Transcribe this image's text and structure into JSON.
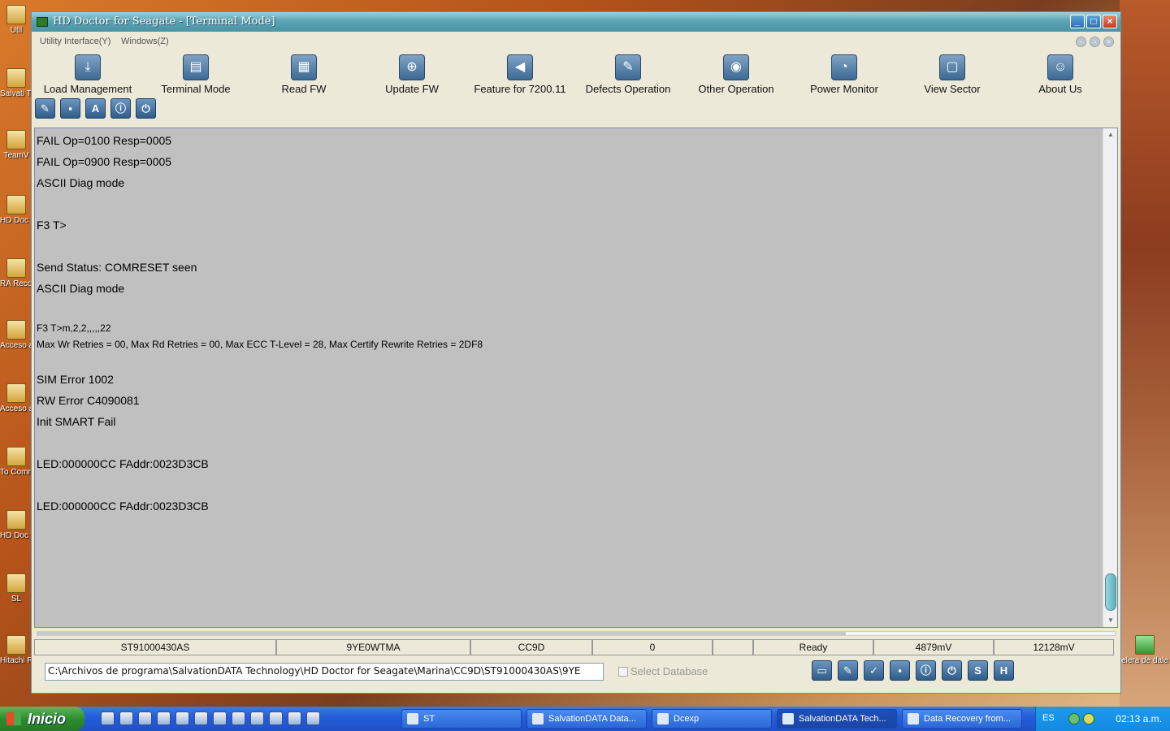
{
  "desktop": {
    "left_icons": [
      {
        "label": "Util"
      },
      {
        "label": "Salvati Techn"
      },
      {
        "label": "TeamV"
      },
      {
        "label": "HD Doc Hita"
      },
      {
        "label": "RA Recor"
      },
      {
        "label": "Acceso a Cryst"
      },
      {
        "label": "Acceso a testd"
      },
      {
        "label": "To Comm"
      },
      {
        "label": "HD Doc Wester"
      },
      {
        "label": "SL"
      },
      {
        "label": "Hitachi Repai"
      }
    ],
    "right_icons": [
      {
        "label": "elera de dale"
      }
    ]
  },
  "window": {
    "title": "HD Doctor for Seagate - [Terminal Mode]",
    "controls": {
      "minimize": "_",
      "maximize": "□",
      "close": "×"
    },
    "menu": [
      {
        "label": "Utility Interface(Y)"
      },
      {
        "label": "Windows(Z)"
      }
    ],
    "toolbar": [
      {
        "label": "Load Management",
        "icon": "load-management-icon",
        "glyph": "⤓"
      },
      {
        "label": "Terminal Mode",
        "icon": "terminal-icon",
        "glyph": "▤"
      },
      {
        "label": "Read FW",
        "icon": "read-fw-icon",
        "glyph": "▦"
      },
      {
        "label": "Update FW",
        "icon": "update-fw-icon",
        "glyph": "⊕"
      },
      {
        "label": "Feature for 7200.11",
        "icon": "feature-icon",
        "glyph": "◀"
      },
      {
        "label": "Defects Operation",
        "icon": "defects-icon",
        "glyph": "✎"
      },
      {
        "label": "Other Operation",
        "icon": "disc-icon",
        "glyph": "◉"
      },
      {
        "label": "Power Monitor",
        "icon": "power-monitor-icon",
        "glyph": "◔"
      },
      {
        "label": "View Sector",
        "icon": "view-sector-icon",
        "glyph": "▢"
      },
      {
        "label": "About Us",
        "icon": "about-icon",
        "glyph": "☺"
      }
    ],
    "quickbar": [
      {
        "icon": "edit-icon",
        "glyph": "✎"
      },
      {
        "icon": "save-icon",
        "glyph": "▪"
      },
      {
        "icon": "font-icon",
        "glyph": "A"
      },
      {
        "icon": "info-icon",
        "glyph": "ⓘ"
      },
      {
        "icon": "power-icon",
        "glyph": "⏻"
      }
    ],
    "terminal": {
      "lines": [
        {
          "text": " FAIL Op=0100 Resp=0005",
          "small": false
        },
        {
          "text": " FAIL Op=0900 Resp=0005",
          "small": false
        },
        {
          "text": "ASCII Diag mode",
          "small": false
        },
        {
          "text": "",
          "small": false
        },
        {
          "text": "F3 T>",
          "small": false
        },
        {
          "text": "",
          "small": false
        },
        {
          "text": "Send Status: COMRESET seen",
          "small": false
        },
        {
          "text": "ASCII Diag mode",
          "small": false
        },
        {
          "text": "",
          "small": false
        },
        {
          "text": "F3 T>m,2,2,,,,,22",
          "small": true
        },
        {
          "text": "Max Wr Retries = 00, Max Rd Retries = 00, Max ECC T-Level = 28, Max Certify Rewrite Retries = 2DF8",
          "small": true
        },
        {
          "text": "",
          "small": true
        },
        {
          "text": " SIM Error 1002",
          "small": false
        },
        {
          "text": " RW Error C4090081",
          "small": false
        },
        {
          "text": "Init SMART Fail",
          "small": false
        },
        {
          "text": "",
          "small": false
        },
        {
          "text": "LED:000000CC FAddr:0023D3CB",
          "small": false
        },
        {
          "text": "",
          "small": false
        },
        {
          "text": "LED:000000CC FAddr:0023D3CB",
          "small": false
        }
      ],
      "scroll_up": "▲",
      "scroll_down": "▼"
    },
    "progress": 0.75,
    "status": [
      {
        "text": "ST91000430AS"
      },
      {
        "text": "9YE0WTMA"
      },
      {
        "text": "CC9D"
      },
      {
        "text": "0"
      },
      {
        "text": ""
      },
      {
        "text": "Ready"
      },
      {
        "text": "4879mV"
      },
      {
        "text": "12128mV"
      }
    ],
    "path_value": "C:\\Archivos de programa\\SalvationDATA Technology\\HD Doctor for Seagate\\Marina\\CC9D\\ST91000430AS\\9YE",
    "select_database_label": "Select Database",
    "bottom_tools": [
      {
        "icon": "folder-icon",
        "glyph": "▭"
      },
      {
        "icon": "edit-icon",
        "glyph": "✎"
      },
      {
        "icon": "check-icon",
        "glyph": "✓"
      },
      {
        "icon": "save-icon",
        "glyph": "▪"
      },
      {
        "icon": "info-icon",
        "glyph": "ⓘ"
      },
      {
        "icon": "power-icon",
        "glyph": "⏻"
      },
      {
        "icon": "s-icon",
        "glyph": "S"
      },
      {
        "icon": "h-icon",
        "glyph": "H"
      }
    ]
  },
  "taskbar": {
    "start_label": "Inicio",
    "tasks": [
      {
        "label": "ST",
        "active": false
      },
      {
        "label": "SalvationDATA Data...",
        "active": false
      },
      {
        "label": "Dcexp",
        "active": false
      },
      {
        "label": "SalvationDATA Tech...",
        "active": true
      },
      {
        "label": "Data Recovery from...",
        "active": false
      }
    ],
    "language": "ES",
    "clock": "02:13 a.m."
  },
  "colors": {
    "terminal_bg": "#c0c0c0",
    "titlebar": "#5aa4b4",
    "taskbar": "#245edb"
  }
}
